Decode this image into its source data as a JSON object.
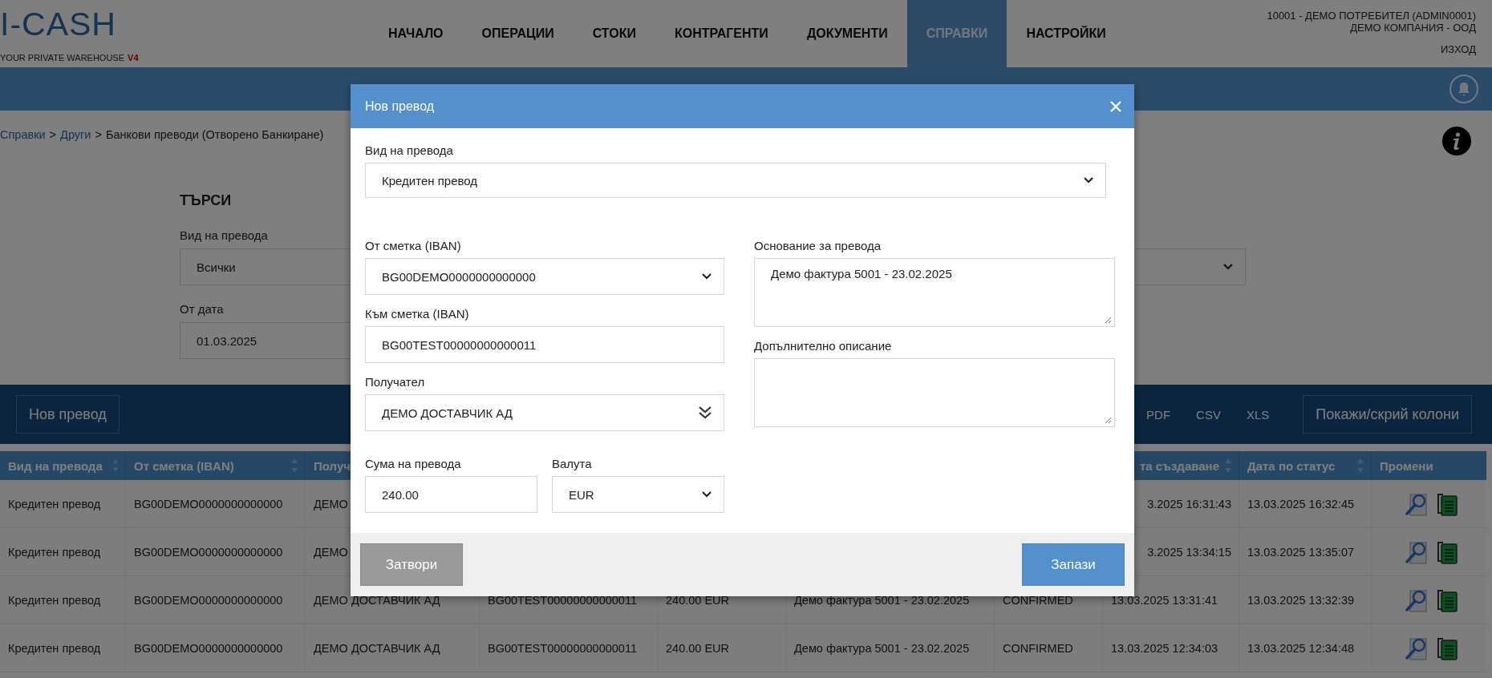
{
  "header": {
    "logo": "I-CASH",
    "tagline": "YOUR PRIVATE WAREHOUSE",
    "version": "V4",
    "nav": [
      {
        "label": "НАЧАЛО",
        "selected": false
      },
      {
        "label": "ОПЕРАЦИИ",
        "selected": false
      },
      {
        "label": "СТОКИ",
        "selected": false
      },
      {
        "label": "КОНТРАГЕНТИ",
        "selected": false
      },
      {
        "label": "ДОКУМЕНТИ",
        "selected": false
      },
      {
        "label": "СПРАВКИ",
        "selected": true
      },
      {
        "label": "НАСТРОЙКИ",
        "selected": false
      }
    ],
    "user": "10001 - ДЕМО ПОТРЕБИТЕЛ (ADMIN0001)",
    "company": "ДЕМО КОМПАНИЯ - ООД",
    "logout": "ИЗХОД"
  },
  "breadcrumb": {
    "separator": ">",
    "items": [
      {
        "label": "Справки",
        "link": true
      },
      {
        "label": "Други",
        "link": true
      },
      {
        "label": "Банкови преводи (Отворено Банкиране)",
        "link": false
      }
    ]
  },
  "search": {
    "title": "ТЪРСИ",
    "fields": [
      {
        "label": "Вид на превода",
        "value": "Всички",
        "kind": "input"
      },
      {
        "kind": "select"
      },
      {
        "label": "От дата",
        "value": "01.03.2025",
        "kind": "input"
      }
    ]
  },
  "toolbar": {
    "new_button": "Нов превод",
    "exports": [
      "PDF",
      "CSV",
      "XLS"
    ],
    "columns_button": "Покажи/скрий колони"
  },
  "table": {
    "columns": [
      {
        "label": "Вид на превода",
        "sortable": true
      },
      {
        "label": "От сметка (IBAN)",
        "sortable": true
      },
      {
        "label": "Получ"
      },
      null,
      null,
      null,
      null,
      {
        "label": "та създаване",
        "sortable": true
      },
      {
        "label": "Дата по статус",
        "sortable": true
      },
      {
        "label": "Промени",
        "sortable": false
      }
    ],
    "rows": [
      {
        "cells": [
          "Кредитен превод",
          "BG00DEMO0000000000000",
          "ДЕМО",
          null,
          null,
          null,
          null,
          "3.2025 16:31:43",
          "13.03.2025 16:32:45"
        ]
      },
      {
        "cells": [
          "Кредитен превод",
          "BG00DEMO0000000000000",
          "ДЕМО",
          null,
          null,
          null,
          null,
          "3.2025 13:34:15",
          "13.03.2025 13:35:07"
        ]
      },
      {
        "cells": [
          "Кредитен превод",
          "BG00DEMO0000000000000",
          "ДЕМО ДОСТАВЧИК АД",
          "BG00TEST00000000000011",
          "240.00 EUR",
          "Демо фактура 5001 - 23.02.2025",
          "CONFIRMED",
          "13.03.2025 13:31:41",
          "13.03.2025 13:32:39"
        ]
      },
      {
        "cells": [
          "Кредитен превод",
          "BG00DEMO0000000000000",
          "ДЕМО ДОСТАВЧИК АД",
          "BG00TEST00000000000011",
          "240.00 EUR",
          "Демо фактура 5001 - 23.02.2025",
          "CONFIRMED",
          "13.03.2025 12:34:03",
          "13.03.2025 12:34:48"
        ]
      }
    ]
  },
  "modal": {
    "title": "Нов превод",
    "type_field": {
      "label": "Вид на превода",
      "value": "Кредитен превод",
      "kind": "select"
    },
    "left": [
      {
        "label": "От сметка (IBAN)",
        "value": "BG00DEMO0000000000000",
        "kind": "select"
      },
      {
        "label": "Към сметка (IBAN)",
        "value": "BG00TEST00000000000011",
        "kind": "input"
      },
      {
        "label": "Получател",
        "value": "ДЕМО ДОСТАВЧИК АД",
        "kind": "lookup"
      }
    ],
    "amount_row": [
      {
        "label": "Сума на превода",
        "value": "240.00",
        "kind": "input"
      },
      {
        "label": "Валута",
        "value": "EUR",
        "kind": "select"
      }
    ],
    "right": [
      {
        "label": "Основание за превода",
        "value": "Демо фактура 5001 - 23.02.2025",
        "kind": "textarea"
      },
      {
        "label": "Допълнително описание",
        "kind": "textarea"
      }
    ],
    "buttons": [
      {
        "label": "Затвори",
        "kind": "secondary"
      },
      {
        "label": "Запази",
        "kind": "primary"
      }
    ]
  }
}
